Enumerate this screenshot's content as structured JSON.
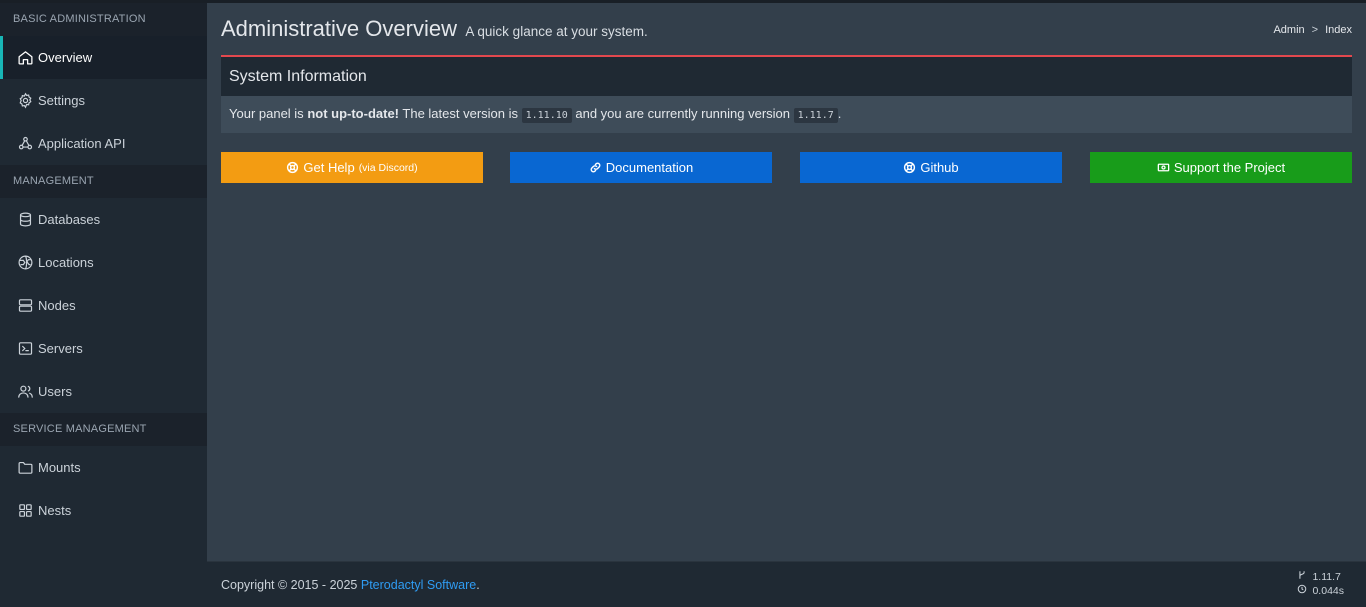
{
  "sidebar": {
    "sections": [
      {
        "header": "BASIC ADMINISTRATION",
        "items": [
          {
            "label": "Overview",
            "icon": "home-icon",
            "active": true
          },
          {
            "label": "Settings",
            "icon": "gear-icon"
          },
          {
            "label": "Application API",
            "icon": "webhook-icon"
          }
        ]
      },
      {
        "header": "MANAGEMENT",
        "items": [
          {
            "label": "Databases",
            "icon": "database-icon"
          },
          {
            "label": "Locations",
            "icon": "globe-icon"
          },
          {
            "label": "Nodes",
            "icon": "server-icon"
          },
          {
            "label": "Servers",
            "icon": "terminal-icon"
          },
          {
            "label": "Users",
            "icon": "users-icon"
          }
        ]
      },
      {
        "header": "SERVICE MANAGEMENT",
        "items": [
          {
            "label": "Mounts",
            "icon": "folder-icon"
          },
          {
            "label": "Nests",
            "icon": "grid-icon"
          }
        ]
      }
    ]
  },
  "header": {
    "title": "Administrative Overview",
    "subtitle": "A quick glance at your system.",
    "breadcrumb": [
      "Admin",
      ">",
      "Index"
    ]
  },
  "system_info": {
    "title": "System Information",
    "text_prefix": "Your panel is ",
    "text_bold": "not up-to-date!",
    "text_mid": " The latest version is ",
    "latest_version": "1.11.10",
    "text_mid2": " and you are currently running version ",
    "current_version": "1.11.7",
    "text_end": "."
  },
  "buttons": {
    "help_label": "Get Help",
    "help_small": "(via Discord)",
    "docs_label": "Documentation",
    "github_label": "Github",
    "support_label": "Support the Project"
  },
  "footer": {
    "copyright_prefix": "Copyright © 2015 - 2025 ",
    "copyright_link": "Pterodactyl Software",
    "copyright_suffix": ".",
    "version": "1.11.7",
    "time": "0.044s"
  },
  "colors": {
    "accent_active": "#18b6b6",
    "danger_border": "#e3484e",
    "help": "#f39c12",
    "docs": "#0967d2",
    "github": "#0967d2",
    "support": "#189c1a",
    "link": "#2f9cf3"
  }
}
